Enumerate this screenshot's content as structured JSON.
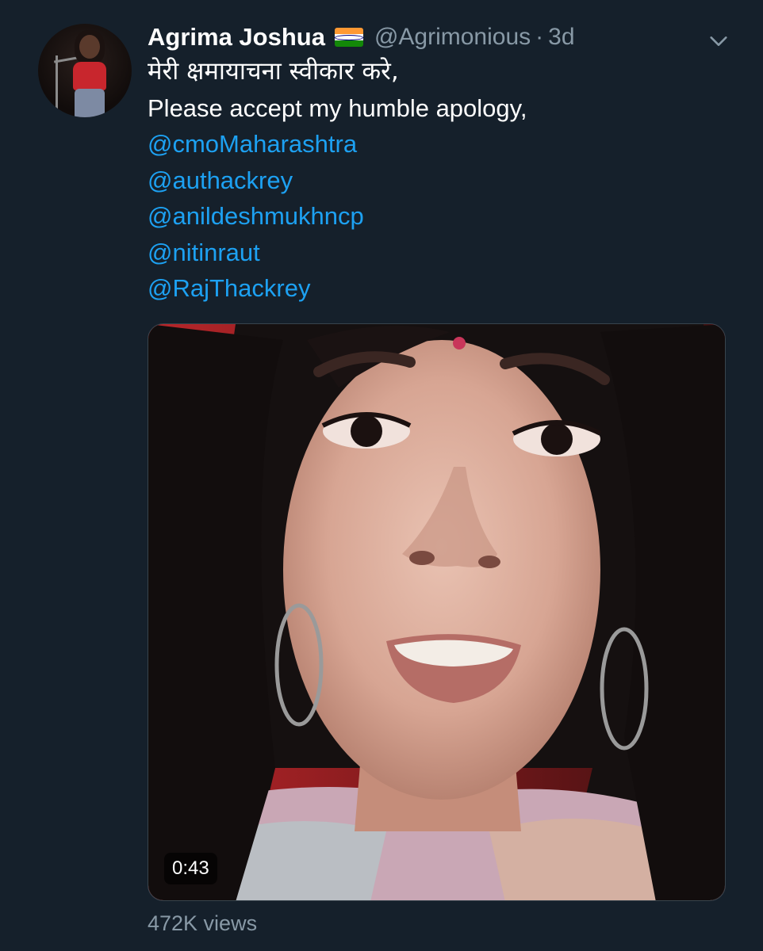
{
  "tweet": {
    "author_name": "Agrima Joshua",
    "handle": "@Agrimonious",
    "separator": "·",
    "time": "3d",
    "text_hindi": "मेरी क्षमायाचना स्वीकार करे,",
    "text_english": "Please accept my humble apology,",
    "mentions": [
      "@cmoMaharashtra",
      "@authackrey",
      "@anildeshmukhncp",
      "@nitinraut",
      "@RajThackrey"
    ],
    "video": {
      "duration": "0:43"
    },
    "views": "472K views"
  },
  "icons": {
    "flag": "india-flag-icon",
    "menu": "chevron-down-icon"
  },
  "colors": {
    "background": "#15202b",
    "link": "#1da1f2",
    "secondary_text": "#8899a6"
  }
}
